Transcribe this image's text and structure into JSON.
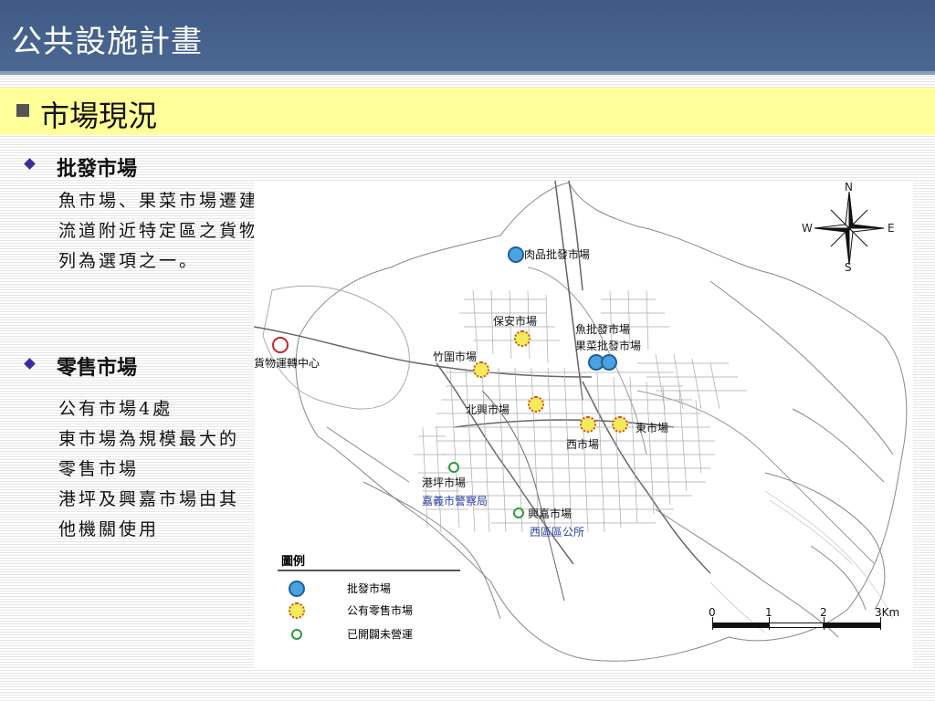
{
  "header": {
    "title": "公共設施計畫"
  },
  "subheading": {
    "title": "市場現況"
  },
  "wholesale": {
    "title": "批發市場",
    "lines": [
      "魚市場、果菜市場遷建至嘉義交",
      "流道附近特定區之貨物運轉中心",
      "列為選項之一。"
    ]
  },
  "retail": {
    "title": "零售市場",
    "lines": [
      "公有市場4處",
      "東市場為規模最大的",
      "零售市場",
      "港坪及興嘉市場由其",
      "他機關使用"
    ]
  },
  "map": {
    "labels": {
      "meat": "肉品批發市場",
      "baoan": "保安市場",
      "fish": "魚批發市場",
      "fruit": "果菜批發市場",
      "zhuwei": "竹圍市場",
      "freight": "貨物運轉中心",
      "beixing": "北興市場",
      "dong": "東市場",
      "xi": "西市場",
      "gangping": "港坪市場",
      "police": "嘉義市警察局",
      "xingjia": "興嘉市場",
      "westdistrict": "西區區公所"
    },
    "legend": {
      "title": "圖例",
      "wholesale": "批發市場",
      "retail": "公有零售市場",
      "unused": "已開闢未營運"
    },
    "compass": {
      "n": "N",
      "s": "S",
      "e": "E",
      "w": "W"
    },
    "scale": {
      "t0": "0",
      "t1": "1",
      "t2": "2",
      "t3": "3Km"
    }
  }
}
